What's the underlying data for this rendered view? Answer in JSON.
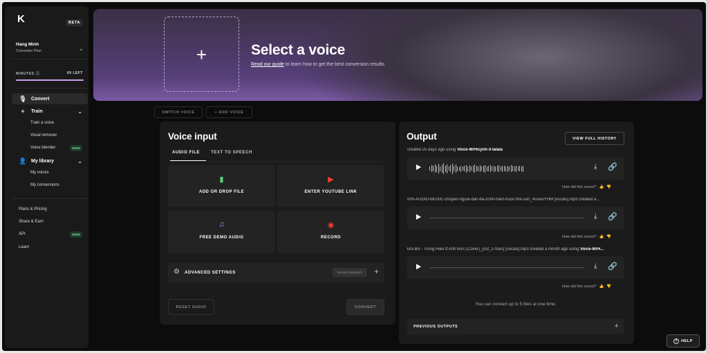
{
  "sidebar": {
    "logo": "K",
    "beta": "BETA",
    "user": {
      "name": "Hang Minh",
      "plan": "Converter Plan"
    },
    "minutes_label": "MINUTES",
    "minutes_left": "60 LEFT",
    "minutes_fraction": 1.0,
    "nav": [
      {
        "label": "Convert",
        "icon": "microphone-icon",
        "active": true
      },
      {
        "label": "Train",
        "icon": "plus-icon"
      },
      {
        "label": "Train a voice"
      },
      {
        "label": "Vocal remover"
      },
      {
        "label": "Voice blender",
        "badge": "NEW"
      },
      {
        "label": "My library",
        "icon": "user-icon"
      },
      {
        "label": "My voices"
      },
      {
        "label": "My conversions"
      }
    ],
    "footer": [
      {
        "label": "Plans & Pricing"
      },
      {
        "label": "Share & Earn"
      },
      {
        "label": "API",
        "badge": "NEW"
      },
      {
        "label": "Learn"
      }
    ]
  },
  "hero": {
    "title": "Select a voice",
    "guide_link": "Read our guide",
    "guide_text": " to learn how to get the best conversion results."
  },
  "voice_actions": {
    "switch": "SWITCH VOICE",
    "add": "+  ADD VOICE"
  },
  "voice_input": {
    "title": "Voice input",
    "tabs": [
      "AUDIO FILE",
      "TEXT TO SPEECH"
    ],
    "options": [
      "ADD OR DROP FILE",
      "ENTER YOUTUBE LINK",
      "FREE DEMO AUDIO",
      "RECORD"
    ],
    "advanced": "ADVANCED SETTINGS",
    "save_preset": "SAVE PRESET",
    "reset": "RESET AUDIO",
    "convert": "CONVERT"
  },
  "output": {
    "title": "Output",
    "view_history": "VIEW FULL HISTORY",
    "items": [
      {
        "meta": "created 25 days ago using ",
        "voice": "Voice-MrHuynh-3-lalala",
        "rate": "How did this sound?"
      },
      {
        "meta": "000-AUDIO-MUSIC-chuyen-nguoi-dan-ba-2000-nam-truoc-the-son_4UaxvYHM [vocals].mp3 created a...",
        "voice": "",
        "rate": "How did this sound?"
      },
      {
        "meta": "Đôi Bờ - Trung Hiếu ft Anh Đức (Cover)_[cut_27lsec] [vocals].mp3 created a month ago using ",
        "voice": "Voice-MrH...",
        "rate": "How did this sound?"
      }
    ],
    "note": "You can convert up to 5 files at one time.",
    "previous": "PREVIOUS OUTPUTS"
  },
  "help": "HELP"
}
